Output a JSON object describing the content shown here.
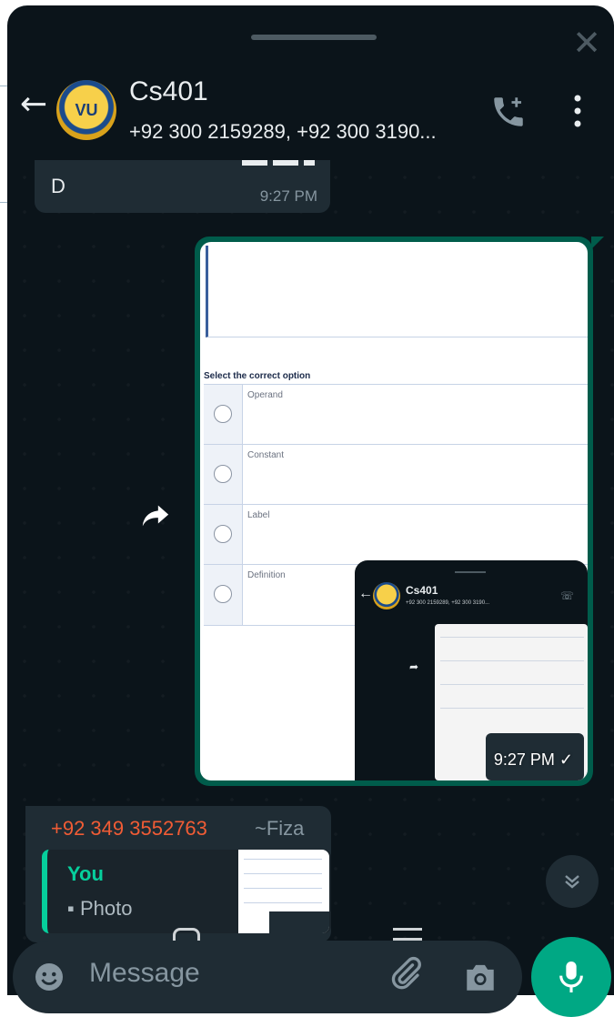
{
  "header": {
    "title": "Cs401",
    "subtitle": "+92 300 2159289, +92 300 3190...",
    "avatar_text": "VU",
    "icons": [
      "back-arrow-icon",
      "add-call-icon",
      "more-vert-icon",
      "close-icon"
    ]
  },
  "messages": {
    "incoming_partial": {
      "text": "D",
      "time": "9:27 PM"
    },
    "image_message": {
      "question_heading": "Select the correct option",
      "options": [
        "Operand",
        "Constant",
        "Label",
        "Definition"
      ],
      "nested_title": "Cs401",
      "nested_subtitle": "+92 300 2159289, +92 300 3190...",
      "time": "9:27 PM",
      "status": "sent-check-icon"
    },
    "reply_message": {
      "sender": "+92 349 3552763",
      "nickname": "~Fiza",
      "quoted_author": "You",
      "quoted_type": "Photo"
    }
  },
  "composer": {
    "placeholder": "Message"
  },
  "colors": {
    "background": "#0b141a",
    "bubble_incoming": "#1f2c34",
    "bubble_outgoing": "#005c4b",
    "accent": "#00a884",
    "sender_name": "#f15c35",
    "quote_author": "#06cf9c"
  }
}
